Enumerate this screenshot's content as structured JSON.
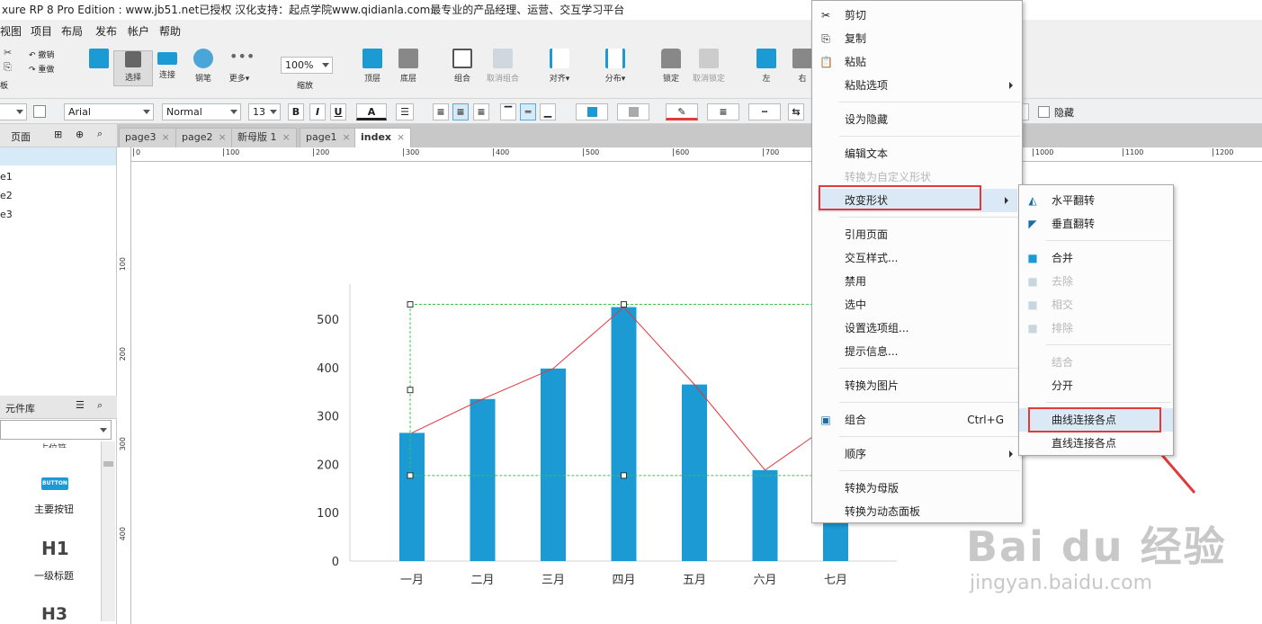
{
  "title": "xure RP 8 Pro Edition : www.jb51.net已授权 汉化支持：起点学院www.qidianla.com最专业的产品经理、运营、交互学习平台",
  "menu": [
    "视图",
    "项目",
    "布局",
    "发布",
    "帐户",
    "帮助"
  ],
  "toolbar": {
    "undo": "撤销",
    "redo": "重做",
    "left_edge": "板",
    "select": "选择",
    "connect": "连接",
    "pen": "钢笔",
    "more": "更多▾",
    "zoom_value": "100%",
    "zoom_label": "缩放",
    "front": "顶层",
    "back": "底层",
    "group": "组合",
    "ungroup": "取消组合",
    "align": "对齐▾",
    "distribute": "分布▾",
    "lock": "锁定",
    "unlock": "取消锁定",
    "left": "左",
    "right": "右"
  },
  "format": {
    "font": "Arial",
    "style": "Normal",
    "size": "13",
    "bold": "B",
    "italic": "I",
    "underline": "U",
    "hidden_label": "隐藏"
  },
  "pages_panel": {
    "title": "页面",
    "items": [
      "e1",
      "e2",
      "e3"
    ]
  },
  "library_panel": {
    "title": "元件库",
    "cut_label": "占位符",
    "button_icon_text": "BUTTON",
    "button_label": "主要按钮",
    "h1": "H1",
    "h1_label": "一级标题",
    "h3": "H3"
  },
  "tabs": [
    {
      "label": "page3"
    },
    {
      "label": "page2"
    },
    {
      "label": "新母版 1"
    },
    {
      "label": "page1"
    },
    {
      "label": "index"
    }
  ],
  "ruler": {
    "h": [
      "0",
      "100",
      "200",
      "300",
      "400",
      "500",
      "600",
      "700",
      "1000",
      "1100",
      "1200"
    ],
    "v": [
      "100",
      "200",
      "300",
      "400"
    ]
  },
  "chart_data": {
    "type": "bar",
    "categories": [
      "一月",
      "二月",
      "三月",
      "四月",
      "五月",
      "六月",
      "七月"
    ],
    "values": [
      265,
      335,
      398,
      525,
      365,
      188,
      290
    ],
    "line_values": [
      265,
      335,
      398,
      525,
      365,
      188,
      290
    ],
    "yticks": [
      "0",
      "100",
      "200",
      "300",
      "400",
      "500"
    ],
    "ylim": [
      0,
      560
    ],
    "bar_color": "#1b9ad4",
    "line_color": "#e8323c"
  },
  "context_menu": {
    "items": [
      {
        "label": "剪切",
        "icon": "scissors-icon",
        "disabled": false
      },
      {
        "label": "复制",
        "icon": "copy-icon",
        "disabled": false
      },
      {
        "label": "粘贴",
        "icon": "paste-icon",
        "disabled": false
      },
      {
        "label": "粘贴选项",
        "icon": "",
        "disabled": false,
        "sub": true
      },
      {
        "label": "设为隐藏",
        "icon": "",
        "disabled": false
      },
      {
        "label": "编辑文本",
        "icon": "",
        "disabled": false
      },
      {
        "label": "转换为自定义形状",
        "icon": "",
        "disabled": true
      },
      {
        "label": "改变形状",
        "icon": "",
        "disabled": false,
        "sub": true
      },
      {
        "label": "引用页面",
        "icon": "",
        "disabled": false
      },
      {
        "label": "交互样式...",
        "icon": "",
        "disabled": false
      },
      {
        "label": "禁用",
        "icon": "",
        "disabled": false
      },
      {
        "label": "选中",
        "icon": "",
        "disabled": false
      },
      {
        "label": "设置选项组...",
        "icon": "",
        "disabled": false
      },
      {
        "label": "提示信息...",
        "icon": "",
        "disabled": false
      },
      {
        "label": "转换为图片",
        "icon": "",
        "disabled": false
      },
      {
        "label": "组合",
        "icon": "group-icon",
        "disabled": false,
        "shortcut": "Ctrl+G"
      },
      {
        "label": "顺序",
        "icon": "",
        "disabled": false,
        "sub": true
      },
      {
        "label": "转换为母版",
        "icon": "",
        "disabled": false
      },
      {
        "label": "转换为动态面板",
        "icon": "",
        "disabled": false
      }
    ]
  },
  "submenu": {
    "items": [
      {
        "label": "水平翻转",
        "icon": "flip-horizontal-icon",
        "disabled": false
      },
      {
        "label": "垂直翻转",
        "icon": "flip-vertical-icon",
        "disabled": false
      },
      {
        "label": "合并",
        "icon": "union-icon",
        "disabled": false
      },
      {
        "label": "去除",
        "icon": "subtract-icon",
        "disabled": true
      },
      {
        "label": "相交",
        "icon": "intersect-icon",
        "disabled": true
      },
      {
        "label": "排除",
        "icon": "exclude-icon",
        "disabled": true
      },
      {
        "label": "结合",
        "icon": "",
        "disabled": true
      },
      {
        "label": "分开",
        "icon": "",
        "disabled": false
      },
      {
        "label": "曲线连接各点",
        "icon": "",
        "disabled": false
      },
      {
        "label": "直线连接各点",
        "icon": "",
        "disabled": false
      }
    ]
  },
  "watermark": {
    "brand": "Bai du 经验",
    "url": "jingyan.baidu.com"
  }
}
